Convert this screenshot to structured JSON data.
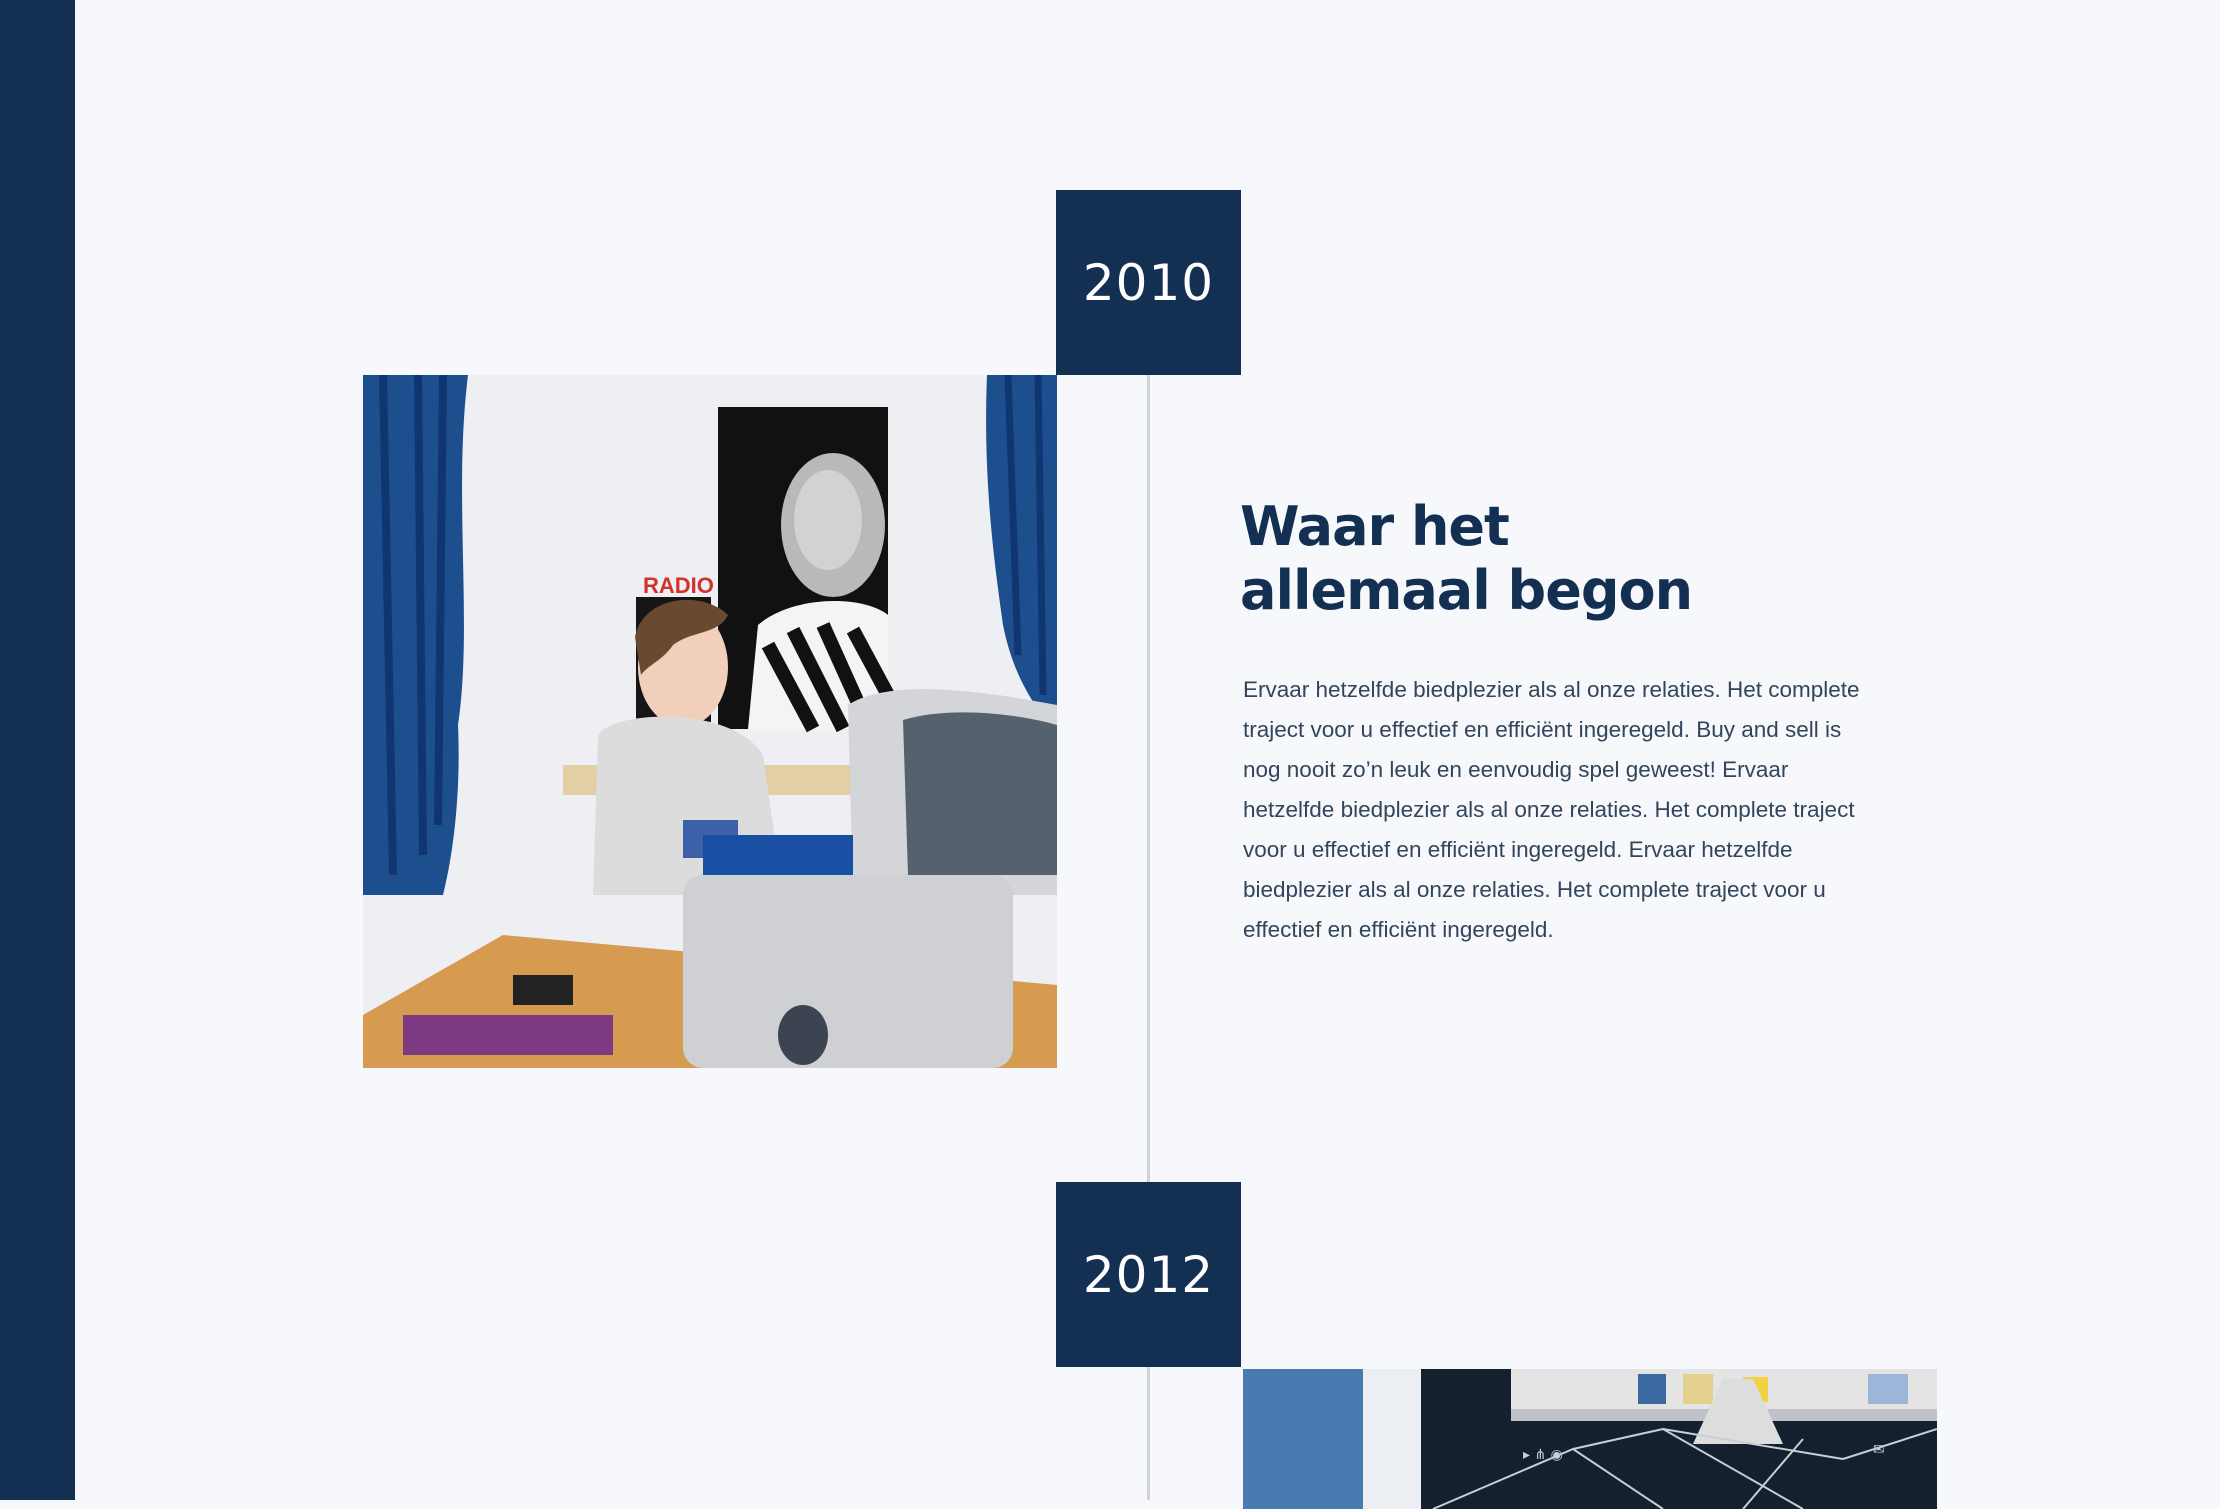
{
  "timeline": [
    {
      "year": "2010",
      "title_line1": "Waar het",
      "title_line2": "allemaal begon",
      "body": "Ervaar hetzelfde biedplezier als al onze relaties. Het complete traject voor u effectief en efficiënt ingeregeld. Buy and sell is nog nooit zo’n leuk en eenvoudig spel geweest! Ervaar hetzelfde biedplezier als al onze relaties. Het complete traject voor u effectief en efficiënt ingeregeld. Ervaar hetzelfde biedplezier als al onze relaties. Het complete traject voor u effectief en efficiënt ingeregeld."
    },
    {
      "year": "2012"
    }
  ],
  "photo_1": {
    "poster_text": "RADIO"
  },
  "colors": {
    "brand_navy": "#132f52",
    "background": "#f6f8fc",
    "timeline_line": "#cfd3d9",
    "body_text": "#33455a"
  }
}
